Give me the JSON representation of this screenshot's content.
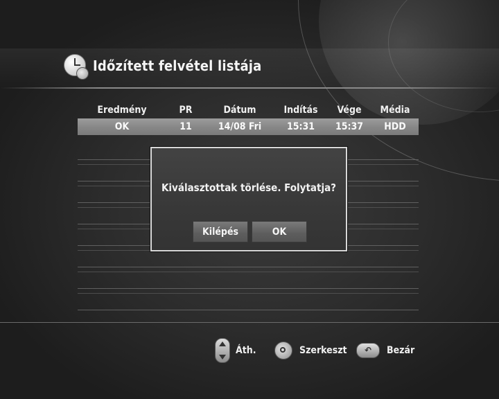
{
  "header": {
    "title": "Időzített felvétel listája",
    "icon": "clock-icon"
  },
  "table": {
    "columns": [
      "Eredmény",
      "PR",
      "Dátum",
      "Indítás",
      "Vége",
      "Média"
    ],
    "rows": [
      {
        "result": "OK",
        "pr": "11",
        "date": "14/08 Fri",
        "start": "15:31",
        "end": "15:37",
        "media": "HDD"
      }
    ],
    "selected_row": 0
  },
  "dialog": {
    "message": "Kiválasztottak törlése. Folytatja?",
    "buttons": {
      "exit": "Kilépés",
      "ok": "OK"
    }
  },
  "footer": {
    "move": {
      "icon": "up-down-nav-icon",
      "label": "Áth."
    },
    "edit": {
      "icon": "ok-button-icon",
      "label": "Szerkeszt"
    },
    "close": {
      "icon": "return-button-icon",
      "label": "Bezár"
    }
  },
  "colors": {
    "accent": "#d8d8d8",
    "selected_row": "#8a8a8a",
    "background": "#2b2b2b"
  }
}
